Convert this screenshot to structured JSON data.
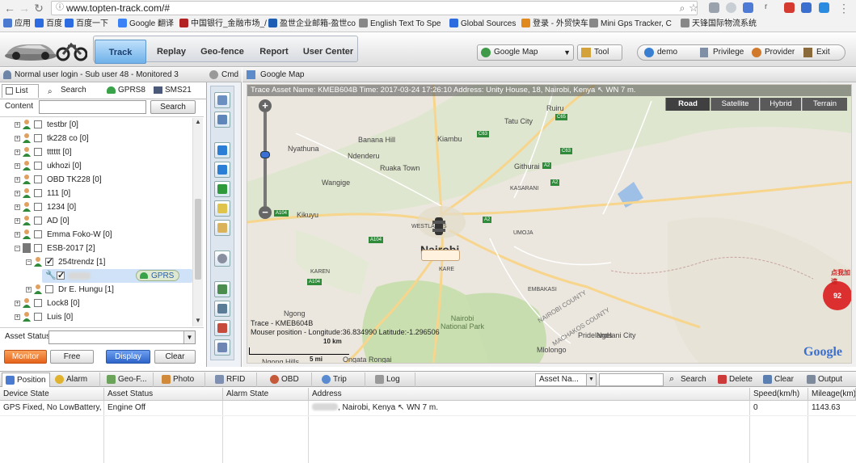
{
  "browser": {
    "url": "www.topten-track.com/#",
    "bookmarks": [
      {
        "label": "应用",
        "color": "#4a7bd0"
      },
      {
        "label": "百度",
        "color": "#2d6ce0"
      },
      {
        "label": "百度一下",
        "color": "#2d6ce0"
      },
      {
        "label": "Google 翻译",
        "color": "#3b82f6"
      },
      {
        "label": "中国银行_金融市场_/",
        "color": "#b22222"
      },
      {
        "label": "盈世企业邮箱-盈世co",
        "color": "#1e5fb4"
      },
      {
        "label": "English Text To Spe",
        "color": "#888888"
      },
      {
        "label": "Global Sources",
        "color": "#2d6ce0"
      },
      {
        "label": "登录 - 外贸快车",
        "color": "#e08a1e"
      },
      {
        "label": "Mini Gps Tracker, C",
        "color": "#888888"
      },
      {
        "label": "天锋国际物流系统",
        "color": "#888888"
      }
    ]
  },
  "header": {
    "nav": [
      "Track",
      "Replay",
      "Geo-fence",
      "Report",
      "User Center"
    ],
    "active_tab": "Track",
    "map_select": "Google Map",
    "tool_button": "Tool",
    "user_button": "demo",
    "privilege_button": "Privilege",
    "provider_button": "Provider",
    "exit_button": "Exit"
  },
  "left": {
    "login_text": "Normal user login - Sub user 48 - Monitored 3",
    "tabs": [
      "List",
      "Search",
      "GPRS8",
      "SMS21"
    ],
    "content_label": "Content",
    "content_value": "",
    "search_button": "Search",
    "tree": [
      {
        "label": "testbr [0]",
        "level": 0,
        "expanded": false,
        "checked": false,
        "group": false
      },
      {
        "label": "tk228 co [0]",
        "level": 0,
        "expanded": false,
        "checked": false,
        "group": false
      },
      {
        "label": "tttttt [0]",
        "level": 0,
        "expanded": false,
        "checked": false,
        "group": false
      },
      {
        "label": "ukhozi [0]",
        "level": 0,
        "expanded": false,
        "checked": false,
        "group": false
      },
      {
        "label": "OBD TK228 [0]",
        "level": 0,
        "expanded": false,
        "checked": false,
        "group": false
      },
      {
        "label": "111 [0]",
        "level": 0,
        "expanded": false,
        "checked": false,
        "group": false
      },
      {
        "label": "1234 [0]",
        "level": 0,
        "expanded": false,
        "checked": false,
        "group": false
      },
      {
        "label": "AD [0]",
        "level": 0,
        "expanded": false,
        "checked": false,
        "group": false
      },
      {
        "label": "Emma Foko-W [0]",
        "level": 0,
        "expanded": false,
        "checked": false,
        "group": false
      },
      {
        "label": "ESB-2017 [2]",
        "level": 0,
        "expanded": true,
        "checked": false,
        "group": true
      },
      {
        "label": "254trendz [1]",
        "level": 1,
        "expanded": true,
        "checked": true,
        "group": false
      },
      {
        "label": "",
        "level": 2,
        "expanded": false,
        "checked": true,
        "group": false,
        "device": true,
        "badge": "GPRS"
      },
      {
        "label": "Dr E. Hungu [1]",
        "level": 1,
        "expanded": false,
        "checked": false,
        "group": false
      },
      {
        "label": "Lock8 [0]",
        "level": 0,
        "expanded": false,
        "checked": false,
        "group": false
      },
      {
        "label": "Luis [0]",
        "level": 0,
        "expanded": false,
        "checked": false,
        "group": false
      }
    ],
    "asset_status_label": "Asset Status",
    "asset_status_value": "",
    "buttons": [
      "Monitor",
      "Free",
      "Display",
      "Clear"
    ]
  },
  "cmd_label": "Cmd",
  "map": {
    "header_label": "Google Map",
    "trace_text": "Trace Asset Name: KMEB604B  Time: 2017-03-24 17:26:10  Address: Unity House, 18, Nairobi, Kenya ↖ WN 7 m.",
    "types": [
      "Road",
      "Satellite",
      "Hybrid",
      "Terrain"
    ],
    "selected_type": "Road",
    "places": [
      "Ruiru",
      "Tatu City",
      "Banana Hill",
      "Kiambu",
      "Nyathuna",
      "Ndenderu",
      "Ruaka Town",
      "Githurai",
      "Wangige",
      "KASARANI",
      "Kikuyu",
      "WESTLANDS",
      "Nairobi",
      "KARE",
      "UMOJA",
      "EMBAKASI",
      "NAIROBI COUNTY",
      "MACHAKOS COUNTY",
      "KAREN",
      "Ngong",
      "Nairobi National Park",
      "Pridelands",
      "Ngelani City",
      "Mlolongo",
      "Ongata Rongai",
      "Ngong Hills"
    ],
    "roads": [
      "C63",
      "C65",
      "C63",
      "A2",
      "A2",
      "A104",
      "A104",
      "A2",
      "A104"
    ],
    "info_line1": "Trace - KMEB604B",
    "info_line2": "Mouser position - Longitude:36.834990 Latitude:-1.296506",
    "scale_km": "10 km",
    "scale_mi": "5 mi",
    "google_logo": "Google",
    "side_ad": "点我加速",
    "side_badge": "92"
  },
  "bottom": {
    "tabs": [
      "Position",
      "Alarm",
      "Geo-F...",
      "Photo",
      "RFID",
      "OBD",
      "Trip",
      "Log"
    ],
    "asset_select": "Asset Na...",
    "search": "Search",
    "delete": "Delete",
    "clear": "Clear",
    "output": "Output"
  },
  "grid": {
    "columns": [
      "Device State",
      "Asset Status",
      "Alarm State",
      "Address",
      "Speed(km/h)",
      "Mileage(km)"
    ],
    "rows": [
      {
        "device_state": "GPS Fixed, No LowBattery, E",
        "asset_status": "Engine Off",
        "alarm_state": "",
        "address_suffix": ", Nairobi, Kenya ↖ WN 7 m.",
        "speed": "0",
        "mileage": "1143.63"
      }
    ]
  }
}
